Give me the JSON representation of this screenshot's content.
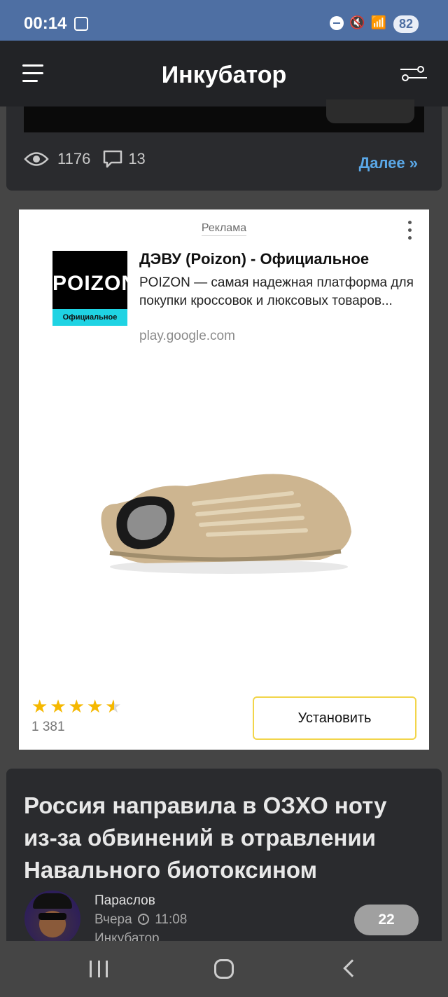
{
  "status_bar": {
    "time": "00:14",
    "battery": "82"
  },
  "header": {
    "title": "Инкубатор"
  },
  "post": {
    "views": "1176",
    "comments": "13",
    "more_label": "Далее »"
  },
  "ad": {
    "label": "Реклама",
    "logo_text": "POIZON",
    "logo_sub": "Официальное",
    "title": "ДЭВУ (Poizon) - Официальное",
    "description": "POIZON — самая надежная платформа для покупки кроссовок и люксовых товаров...",
    "domain": "play.google.com",
    "rating": 4.5,
    "reviews": "1 381",
    "install_label": "Установить"
  },
  "article": {
    "title": "Россия направила в ОЗХО ноту из-за обвинений в отравлении Навального биотоксином",
    "author": "Параслов",
    "day": "Вчера",
    "time": "11:08",
    "community": "Инкубатор",
    "comment_count": "22"
  },
  "colors": {
    "status_bar": "#4e6fa3",
    "header": "#222326",
    "accent_link": "#5aa7e6",
    "star": "#f5b800",
    "install_border": "#f2d54a"
  }
}
